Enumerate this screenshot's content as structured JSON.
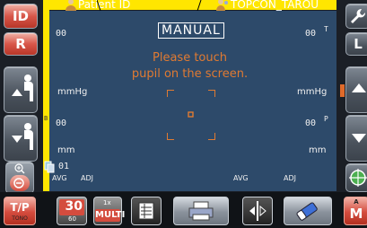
{
  "header": {
    "patient_label": "Patient ID",
    "operator_label": "TOPCON_TAROU"
  },
  "left_panel": {
    "id_label": "ID",
    "r_label": "R"
  },
  "right_panel": {
    "l_label": "L",
    "a_label": "A",
    "m_label": "M"
  },
  "screen": {
    "mode_label": "MANUAL",
    "instruction_line1": "Please touch",
    "instruction_line2": "pupil on the screen.",
    "left_top_value": "00",
    "right_top_value": "00",
    "right_top_suffix": "T",
    "left_mmhg": "mmHg",
    "right_mmhg": "mmHg",
    "left_mid_value": "00",
    "right_mid_value": "00",
    "right_mid_suffix": "P",
    "left_mm": "mm",
    "right_mm": "mm",
    "frame_count": "01",
    "avg_left": "AVG",
    "adj_left": "ADJ",
    "avg_right": "AVG",
    "adj_right": "ADJ",
    "marker_b": "B"
  },
  "toolbar": {
    "tp_label": "T/P",
    "tono_label": "TONO",
    "timer_big": "30",
    "timer_small": "60",
    "multi_small": "1x",
    "multi_label": "MULTI"
  },
  "colors": {
    "screen_bg": "#2d4a6a",
    "accent_yellow": "#ffe600",
    "instruction_orange": "#e07a32",
    "button_red": "#d44c3e"
  }
}
